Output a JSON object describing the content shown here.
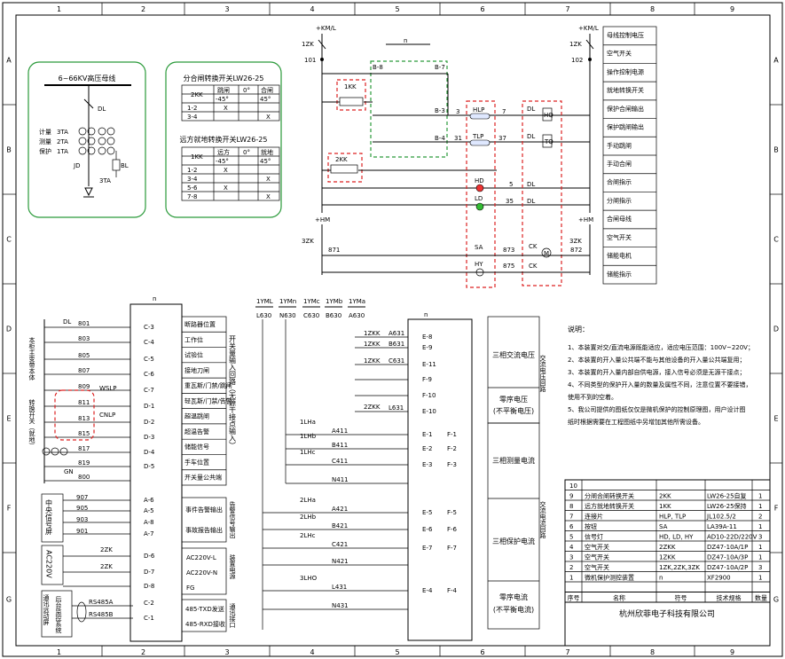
{
  "frame": {
    "cols": [
      "1",
      "2",
      "3",
      "4",
      "5",
      "6",
      "7",
      "8",
      "9"
    ],
    "rows": [
      "A",
      "B",
      "C",
      "D",
      "E",
      "F",
      "G"
    ]
  },
  "busbar_box": {
    "title": "6~66KV高压母线",
    "dl": "DL",
    "ct_labels": [
      "计量",
      "测量",
      "保护"
    ],
    "ct_names": [
      "3TA",
      "2TA",
      "1TA"
    ],
    "jd": "JD",
    "bl": "BL",
    "ta3": "3TA"
  },
  "switch_box": {
    "title1": "分合闸转换开关LW26-25",
    "t1": {
      "label": "2KK",
      "headers": [
        "跳闸",
        "0°",
        "合闸"
      ],
      "angles": [
        "-45°",
        "45°"
      ],
      "rows": [
        [
          "1-2",
          "X",
          ""
        ],
        [
          "3-4",
          "",
          "X"
        ]
      ]
    },
    "title2": "远方就地转换开关LW26-25",
    "t2": {
      "label": "1KK",
      "headers": [
        "远方",
        "0°",
        "就地"
      ],
      "angles": [
        "-45°",
        "45°"
      ],
      "rows": [
        [
          "1-2",
          "X",
          ""
        ],
        [
          "3-4",
          "",
          "X"
        ],
        [
          "5-6",
          "X",
          ""
        ],
        [
          "7-8",
          "",
          "X"
        ]
      ]
    }
  },
  "top_circuit": {
    "km_left": "+KM/L",
    "km_right": "+KM/L",
    "zk1": "1ZK",
    "n101": "101",
    "n102": "102",
    "n_label": "n",
    "b8": "B-8",
    "b7": "B-7",
    "b3": "B-3",
    "b4": "B-4",
    "kk1": "1KK",
    "kk2": "2KK",
    "hlp": "HLP",
    "tlp": "TLP",
    "n3": "3",
    "n7": "7",
    "n31": "31",
    "n37": "37",
    "n5": "5",
    "n35": "35",
    "hq": "HQ",
    "tq": "TQ",
    "dl": "DL",
    "hd": "HD",
    "ld": "LD",
    "hm_left": "+HM",
    "hm_right": "+HM",
    "zk3": "3ZK",
    "n871": "871",
    "n872": "872",
    "n873": "873",
    "n875": "875",
    "sa": "SA",
    "hy": "HY",
    "ck": "CK",
    "m": "M"
  },
  "top_legend": [
    "母线控制电压",
    "空气开关",
    "操作控制电源",
    "就地转换开关",
    "保护合闸输出",
    "保护跳闸输出",
    "手动跳闸",
    "手动合闸",
    "合闸指示",
    "分闸指示",
    "合闸母线",
    "空气开关",
    "储能电机",
    "储能指示"
  ],
  "di_section": {
    "n_label": "n",
    "dl": "DL",
    "wires": [
      "801",
      "803",
      "805",
      "807",
      "809",
      "811",
      "813",
      "815",
      "817",
      "819",
      "800"
    ],
    "terminals": [
      "C-3",
      "C-4",
      "C-5",
      "C-6",
      "C-7",
      "D-1",
      "D-2",
      "D-3",
      "D-4",
      "D-5"
    ],
    "labels": [
      "断路器位置",
      "工作位",
      "试验位",
      "接地刀闸",
      "重瓦斯/门禁/跳闸",
      "轻瓦斯/门禁/告警",
      "超温跳闸",
      "超温告警",
      "储能信号",
      "手车位置",
      "开关量公共端"
    ],
    "group_title": "开关量输入回路（无源干接点输入）",
    "wslp": "WSLP",
    "cnlp": "CNLP",
    "red_note1": "本柜主变带本体",
    "red_note2": "转换开关（就地）",
    "gn": "GN",
    "circles": [
      "①",
      "②",
      "③"
    ]
  },
  "signal_section": {
    "wires": [
      "907",
      "905",
      "903",
      "901"
    ],
    "terminals": [
      "A-6",
      "A-5",
      "A-8",
      "A-7"
    ],
    "group": "中央信号屏",
    "labels": [
      "事件告警输出",
      "事故报告输出"
    ],
    "side": "告警信号输出"
  },
  "power_section": {
    "group": "AC220V",
    "zk2": "2ZK",
    "terminals": [
      "D-6",
      "D-7",
      "D-8"
    ],
    "labels": [
      "AC220V-L",
      "AC220V-N",
      "FG"
    ],
    "side": "装置电源"
  },
  "comm_section": {
    "group": "通讯远动屏",
    "group2": "后台监控系统",
    "rs1": "RS485A",
    "rs2": "RS485B",
    "terminals": [
      "C-2",
      "C-1"
    ],
    "labels": [
      "485-TXD发送",
      "485-RXD接收"
    ],
    "side": "通讯接口"
  },
  "ac_voltage": {
    "buses": [
      "1YML",
      "1YMn",
      "1YMc",
      "1YMb",
      "1YMa"
    ],
    "codes": [
      "L630",
      "N630",
      "C630",
      "B630",
      "A630"
    ],
    "zkk": "1ZKK",
    "zkk2": "2ZKK",
    "nodes": [
      "A631",
      "B631",
      "C631",
      "L631"
    ],
    "terminals": [
      "E-8",
      "E-9",
      "E-11",
      "F-9",
      "F-10",
      "E-10"
    ],
    "n_label": "n",
    "label1": "三相交流电压",
    "label2": "零序电压",
    "label2b": "(不平衡电压)",
    "side": "交流电压回路"
  },
  "ac_current": {
    "ct_meas": [
      "1LHa",
      "1LHb",
      "1LHc"
    ],
    "ct_prot": [
      "2LHa",
      "2LHb",
      "2LHc"
    ],
    "ct_zero": "3LHO",
    "wires_meas": [
      "A411",
      "B411",
      "C411",
      "N411"
    ],
    "wires_prot": [
      "A421",
      "B421",
      "C421",
      "N421"
    ],
    "wires_zero": [
      "L431",
      "N431"
    ],
    "terms_meas": [
      "E-1",
      "E-2",
      "E-3"
    ],
    "terms_meas_f": [
      "F-1",
      "F-2",
      "F-3"
    ],
    "terms_prot": [
      "E-5",
      "E-6",
      "E-7"
    ],
    "terms_prot_f": [
      "F-5",
      "F-6",
      "F-7"
    ],
    "term_zero": "E-4",
    "term_zero_f": "F-4",
    "label1": "三相测量电流",
    "label2": "三相保护电流",
    "label3": "零序电流",
    "label3b": "(不平衡电流)",
    "side": "交流电流回路"
  },
  "notes": {
    "title": "说明：",
    "items": [
      "1、本装置对交/直流电源既能适应，适应电压范围：100V~220V；",
      "2、本装置的开入量公共端不能与其他设备的开入量公共端复用；",
      "3、本装置的开入量内部自供电源，接入信号必须是无源干接点；",
      "4、不同类型的保护开入量的数量及属性不同，注意位置不要接错，",
      "    使用不到的空着。",
      "5、我公司提供的图纸仅仅是微机保护的控制原理图，用户设计图",
      "    纸时根据需要在工程图纸中另增加其他所需设备。"
    ]
  },
  "bom": {
    "headers": [
      "序号",
      "名称",
      "符号",
      "技术规格",
      "数量"
    ],
    "rows": [
      [
        "10",
        "",
        "",
        "",
        ""
      ],
      [
        "9",
        "分闸合闸转换开关",
        "2KK",
        "LW26-25自复",
        "1"
      ],
      [
        "8",
        "远方就地转换开关",
        "1KK",
        "LW26-25保持",
        "1"
      ],
      [
        "7",
        "连接片",
        "HLP, TLP",
        "JL102.5/2",
        "2"
      ],
      [
        "6",
        "按钮",
        "SA",
        "LA39A-11",
        "1"
      ],
      [
        "5",
        "信号灯",
        "HD, LD, HY",
        "AD10-22D/220V",
        "3"
      ],
      [
        "4",
        "空气开关",
        "2ZKK",
        "DZ47-10A/1P",
        "1"
      ],
      [
        "3",
        "空气开关",
        "1ZKK",
        "DZ47-10A/3P",
        "1"
      ],
      [
        "2",
        "空气开关",
        "1ZK,2ZK,3ZK",
        "DZ47-10A/2P",
        "3"
      ],
      [
        "1",
        "微机保护测控装置",
        "n",
        "XF2900",
        "1"
      ]
    ],
    "company": "杭州欣菲电子科技有限公司"
  }
}
